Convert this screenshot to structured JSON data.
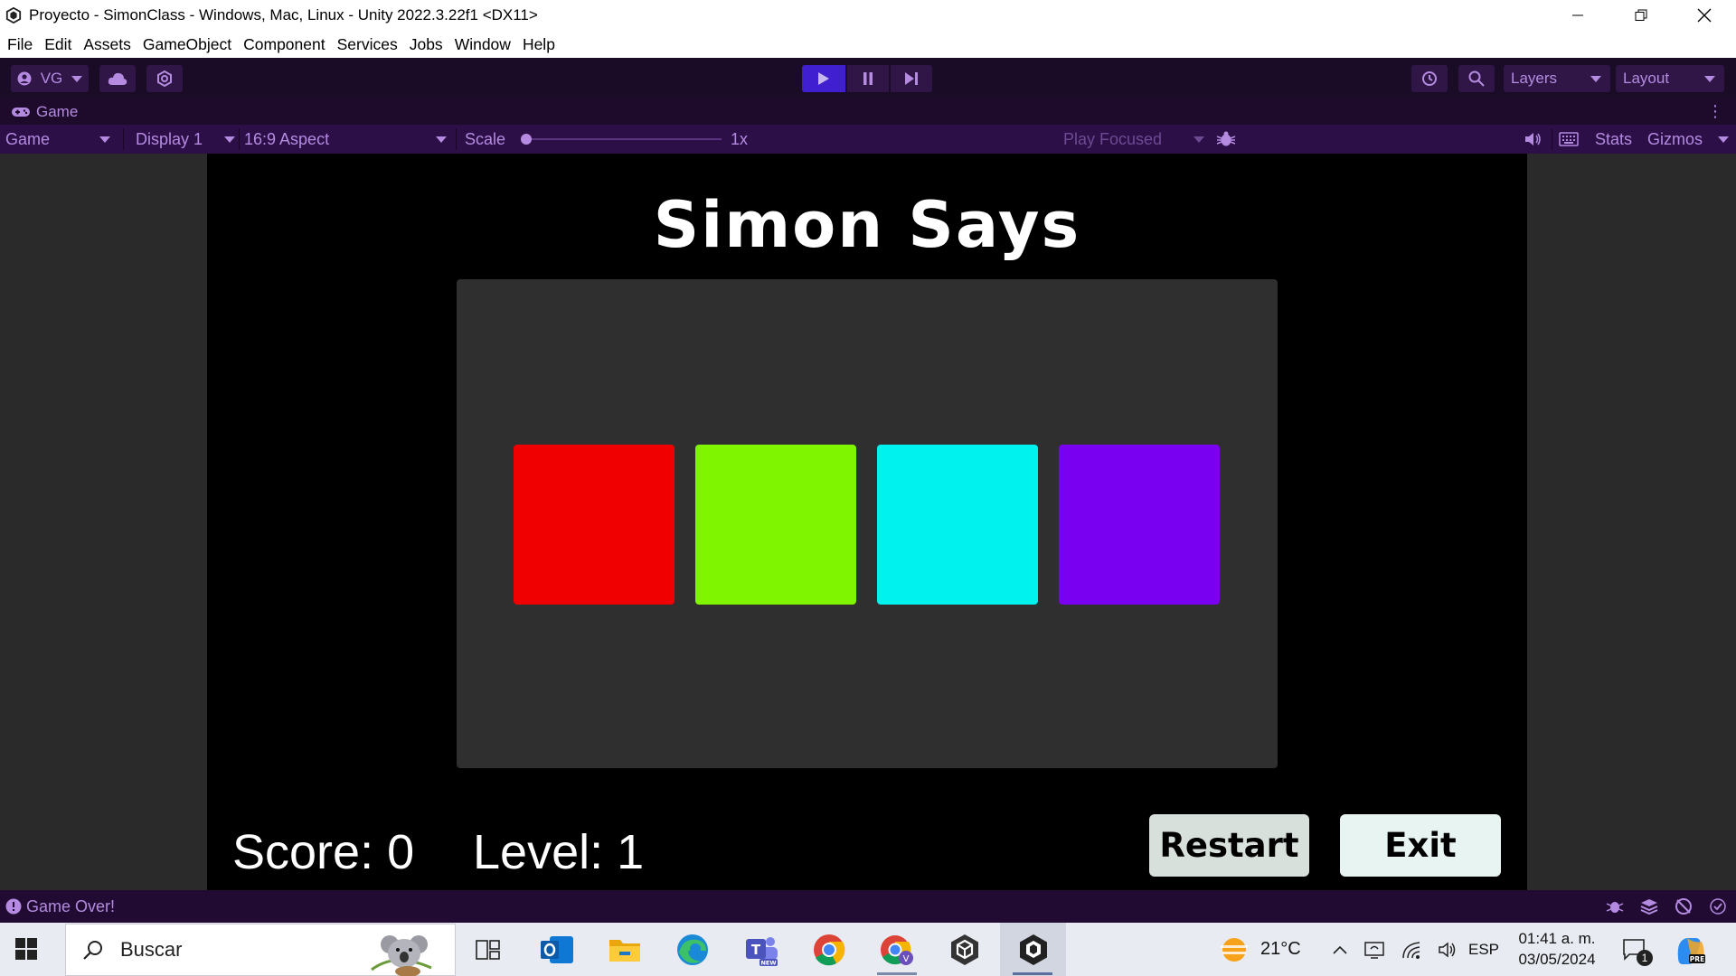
{
  "window": {
    "title": "Proyecto - SimonClass - Windows, Mac, Linux - Unity 2022.3.22f1 <DX11>"
  },
  "menu": [
    "File",
    "Edit",
    "Assets",
    "GameObject",
    "Component",
    "Services",
    "Jobs",
    "Window",
    "Help"
  ],
  "toolbar": {
    "account": "VG",
    "layers": "Layers",
    "layout": "Layout"
  },
  "tab": {
    "label": "Game"
  },
  "gamebar": {
    "view_select": "Game",
    "display": "Display 1",
    "aspect": "16:9 Aspect",
    "scale_label": "Scale",
    "scale_value": "1x",
    "play_mode": "Play Focused",
    "stats": "Stats",
    "gizmos": "Gizmos"
  },
  "game": {
    "title": "Simon Says",
    "score": "Score: 0",
    "level": "Level: 1",
    "restart": "Restart",
    "exit": "Exit",
    "colors": [
      "#f00000",
      "#7ff500",
      "#00f2ef",
      "#7900f0"
    ]
  },
  "status": {
    "message": "Game Over!"
  },
  "taskbar": {
    "search_placeholder": "Buscar",
    "weather": "21°C",
    "language": "ESP",
    "time": "01:41 a. m.",
    "date": "03/05/2024",
    "notification_count": "1"
  },
  "colors": {
    "editor_toolbar": "#1a0b26",
    "gamebar": "#2d0f48",
    "accent": "#b48be0",
    "play_active": "#3f1fd0"
  }
}
